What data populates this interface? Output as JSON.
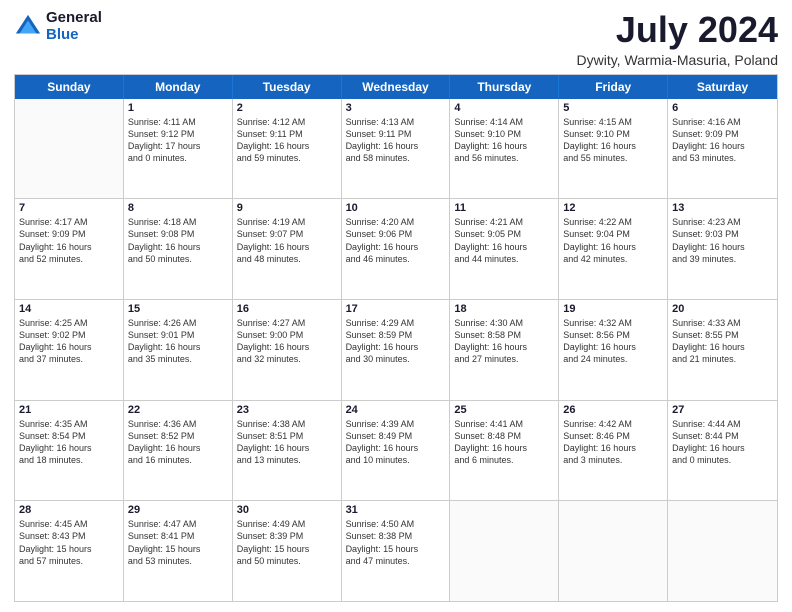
{
  "logo": {
    "general": "General",
    "blue": "Blue"
  },
  "title": "July 2024",
  "location": "Dywity, Warmia-Masuria, Poland",
  "days_of_week": [
    "Sunday",
    "Monday",
    "Tuesday",
    "Wednesday",
    "Thursday",
    "Friday",
    "Saturday"
  ],
  "weeks": [
    [
      {
        "day": "",
        "text": ""
      },
      {
        "day": "1",
        "text": "Sunrise: 4:11 AM\nSunset: 9:12 PM\nDaylight: 17 hours\nand 0 minutes."
      },
      {
        "day": "2",
        "text": "Sunrise: 4:12 AM\nSunset: 9:11 PM\nDaylight: 16 hours\nand 59 minutes."
      },
      {
        "day": "3",
        "text": "Sunrise: 4:13 AM\nSunset: 9:11 PM\nDaylight: 16 hours\nand 58 minutes."
      },
      {
        "day": "4",
        "text": "Sunrise: 4:14 AM\nSunset: 9:10 PM\nDaylight: 16 hours\nand 56 minutes."
      },
      {
        "day": "5",
        "text": "Sunrise: 4:15 AM\nSunset: 9:10 PM\nDaylight: 16 hours\nand 55 minutes."
      },
      {
        "day": "6",
        "text": "Sunrise: 4:16 AM\nSunset: 9:09 PM\nDaylight: 16 hours\nand 53 minutes."
      }
    ],
    [
      {
        "day": "7",
        "text": "Sunrise: 4:17 AM\nSunset: 9:09 PM\nDaylight: 16 hours\nand 52 minutes."
      },
      {
        "day": "8",
        "text": "Sunrise: 4:18 AM\nSunset: 9:08 PM\nDaylight: 16 hours\nand 50 minutes."
      },
      {
        "day": "9",
        "text": "Sunrise: 4:19 AM\nSunset: 9:07 PM\nDaylight: 16 hours\nand 48 minutes."
      },
      {
        "day": "10",
        "text": "Sunrise: 4:20 AM\nSunset: 9:06 PM\nDaylight: 16 hours\nand 46 minutes."
      },
      {
        "day": "11",
        "text": "Sunrise: 4:21 AM\nSunset: 9:05 PM\nDaylight: 16 hours\nand 44 minutes."
      },
      {
        "day": "12",
        "text": "Sunrise: 4:22 AM\nSunset: 9:04 PM\nDaylight: 16 hours\nand 42 minutes."
      },
      {
        "day": "13",
        "text": "Sunrise: 4:23 AM\nSunset: 9:03 PM\nDaylight: 16 hours\nand 39 minutes."
      }
    ],
    [
      {
        "day": "14",
        "text": "Sunrise: 4:25 AM\nSunset: 9:02 PM\nDaylight: 16 hours\nand 37 minutes."
      },
      {
        "day": "15",
        "text": "Sunrise: 4:26 AM\nSunset: 9:01 PM\nDaylight: 16 hours\nand 35 minutes."
      },
      {
        "day": "16",
        "text": "Sunrise: 4:27 AM\nSunset: 9:00 PM\nDaylight: 16 hours\nand 32 minutes."
      },
      {
        "day": "17",
        "text": "Sunrise: 4:29 AM\nSunset: 8:59 PM\nDaylight: 16 hours\nand 30 minutes."
      },
      {
        "day": "18",
        "text": "Sunrise: 4:30 AM\nSunset: 8:58 PM\nDaylight: 16 hours\nand 27 minutes."
      },
      {
        "day": "19",
        "text": "Sunrise: 4:32 AM\nSunset: 8:56 PM\nDaylight: 16 hours\nand 24 minutes."
      },
      {
        "day": "20",
        "text": "Sunrise: 4:33 AM\nSunset: 8:55 PM\nDaylight: 16 hours\nand 21 minutes."
      }
    ],
    [
      {
        "day": "21",
        "text": "Sunrise: 4:35 AM\nSunset: 8:54 PM\nDaylight: 16 hours\nand 18 minutes."
      },
      {
        "day": "22",
        "text": "Sunrise: 4:36 AM\nSunset: 8:52 PM\nDaylight: 16 hours\nand 16 minutes."
      },
      {
        "day": "23",
        "text": "Sunrise: 4:38 AM\nSunset: 8:51 PM\nDaylight: 16 hours\nand 13 minutes."
      },
      {
        "day": "24",
        "text": "Sunrise: 4:39 AM\nSunset: 8:49 PM\nDaylight: 16 hours\nand 10 minutes."
      },
      {
        "day": "25",
        "text": "Sunrise: 4:41 AM\nSunset: 8:48 PM\nDaylight: 16 hours\nand 6 minutes."
      },
      {
        "day": "26",
        "text": "Sunrise: 4:42 AM\nSunset: 8:46 PM\nDaylight: 16 hours\nand 3 minutes."
      },
      {
        "day": "27",
        "text": "Sunrise: 4:44 AM\nSunset: 8:44 PM\nDaylight: 16 hours\nand 0 minutes."
      }
    ],
    [
      {
        "day": "28",
        "text": "Sunrise: 4:45 AM\nSunset: 8:43 PM\nDaylight: 15 hours\nand 57 minutes."
      },
      {
        "day": "29",
        "text": "Sunrise: 4:47 AM\nSunset: 8:41 PM\nDaylight: 15 hours\nand 53 minutes."
      },
      {
        "day": "30",
        "text": "Sunrise: 4:49 AM\nSunset: 8:39 PM\nDaylight: 15 hours\nand 50 minutes."
      },
      {
        "day": "31",
        "text": "Sunrise: 4:50 AM\nSunset: 8:38 PM\nDaylight: 15 hours\nand 47 minutes."
      },
      {
        "day": "",
        "text": ""
      },
      {
        "day": "",
        "text": ""
      },
      {
        "day": "",
        "text": ""
      }
    ]
  ]
}
